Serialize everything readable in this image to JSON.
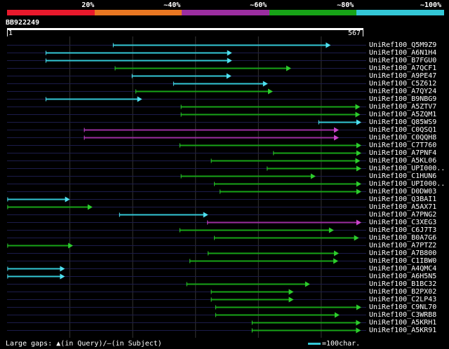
{
  "colors": {
    "red": "#e8192c",
    "orange": "#e87722",
    "purple": "#9b2ea0",
    "green": "#17a317",
    "cyan": "#33c7d6",
    "bright_cyan": "#4fe0f0",
    "bright_green": "#2dcc2d",
    "bright_purple": "#cc44cc",
    "grid": "#333333",
    "row_line": "#1c1c4a"
  },
  "legend": {
    "labels": [
      "20%",
      "~40%",
      "~60%",
      "~80%",
      "~100%"
    ],
    "bands": [
      "red",
      "orange",
      "purple",
      "green",
      "cyan"
    ]
  },
  "query": {
    "id": "BB922249",
    "start_label": "1",
    "end_label": "567",
    "length": 567
  },
  "hits": [
    {
      "name": "UniRef100_Q5M9Z9",
      "color": "cyan",
      "start": 170,
      "end": 515
    },
    {
      "name": "UniRef100_A6N1H4",
      "color": "cyan",
      "start": 63,
      "end": 358
    },
    {
      "name": "UniRef100_B7FGU0",
      "color": "cyan",
      "start": 63,
      "end": 358
    },
    {
      "name": "UniRef100_A7QCF1",
      "color": "green",
      "start": 173,
      "end": 452
    },
    {
      "name": "UniRef100_A9PE47",
      "color": "cyan",
      "start": 200,
      "end": 357
    },
    {
      "name": "UniRef100_C5Z612",
      "color": "cyan",
      "start": 266,
      "end": 415
    },
    {
      "name": "UniRef100_A7QY24",
      "color": "green",
      "start": 206,
      "end": 423
    },
    {
      "name": "UniRef100_B9NBG9",
      "color": "cyan",
      "start": 63,
      "end": 215
    },
    {
      "name": "UniRef100_A5ZTV7",
      "color": "green",
      "start": 278,
      "end": 562
    },
    {
      "name": "UniRef100_A5ZQM1",
      "color": "green",
      "start": 278,
      "end": 562
    },
    {
      "name": "UniRef100_Q85WS9",
      "color": "cyan",
      "start": 497,
      "end": 625
    },
    {
      "name": "UniRef100_C0QSQ1",
      "color": "purple",
      "start": 124,
      "end": 528
    },
    {
      "name": "UniRef100_C0QQH8",
      "color": "purple",
      "start": 124,
      "end": 528
    },
    {
      "name": "UniRef100_C7T760",
      "color": "green",
      "start": 276,
      "end": 620
    },
    {
      "name": "UniRef100_A7PNF4",
      "color": "green",
      "start": 425,
      "end": 623
    },
    {
      "name": "UniRef100_A5KL06",
      "color": "green",
      "start": 326,
      "end": 562
    },
    {
      "name": "UniRef100_UPI000..",
      "color": "green",
      "start": 415,
      "end": 572
    },
    {
      "name": "UniRef100_C1HUN6",
      "color": "green",
      "start": 278,
      "end": 491
    },
    {
      "name": "UniRef100_UPI000..",
      "color": "green",
      "start": 331,
      "end": 622
    },
    {
      "name": "UniRef100_D0DW03",
      "color": "green",
      "start": 340,
      "end": 564
    },
    {
      "name": "UniRef100_Q3BAI1",
      "color": "cyan",
      "start": 2,
      "end": 100
    },
    {
      "name": "UniRef100_A5AX71",
      "color": "green",
      "start": 2,
      "end": 136
    },
    {
      "name": "UniRef100_A7PNG2",
      "color": "cyan",
      "start": 180,
      "end": 320
    },
    {
      "name": "UniRef100_C3XEG3",
      "color": "purple",
      "start": 320,
      "end": 620
    },
    {
      "name": "UniRef100_C6J7T3",
      "color": "green",
      "start": 276,
      "end": 520
    },
    {
      "name": "UniRef100_B0A7G6",
      "color": "green",
      "start": 331,
      "end": 560
    },
    {
      "name": "UniRef100_A7PTZ2",
      "color": "green",
      "start": 2,
      "end": 105
    },
    {
      "name": "UniRef100_A7B800",
      "color": "green",
      "start": 321,
      "end": 528
    },
    {
      "name": "UniRef100_C1IBW0",
      "color": "green",
      "start": 292,
      "end": 527
    },
    {
      "name": "UniRef100_A4QMC4",
      "color": "cyan",
      "start": 2,
      "end": 92
    },
    {
      "name": "UniRef100_A6H5N5",
      "color": "cyan",
      "start": 2,
      "end": 92
    },
    {
      "name": "UniRef100_B1BC32",
      "color": "green",
      "start": 287,
      "end": 482
    },
    {
      "name": "UniRef100_B2PX02",
      "color": "green",
      "start": 326,
      "end": 456
    },
    {
      "name": "UniRef100_C2LP43",
      "color": "green",
      "start": 326,
      "end": 456
    },
    {
      "name": "UniRef100_C9NL70",
      "color": "green",
      "start": 333,
      "end": 620
    },
    {
      "name": "UniRef100_C3WRB8",
      "color": "green",
      "start": 333,
      "end": 529
    },
    {
      "name": "UniRef100_A5KRH1",
      "color": "green",
      "start": 391,
      "end": 563
    },
    {
      "name": "UniRef100_A5KR91",
      "color": "green",
      "start": 391,
      "end": 563
    }
  ],
  "footer": {
    "large_gaps_prefix": "Large gaps:",
    "query_marker": "▲",
    "query_text": "(in Query)/",
    "subject_marker": "–",
    "subject_text": "(in Subject)",
    "scale_label": "=100char.",
    "scale_color": "cyan"
  }
}
